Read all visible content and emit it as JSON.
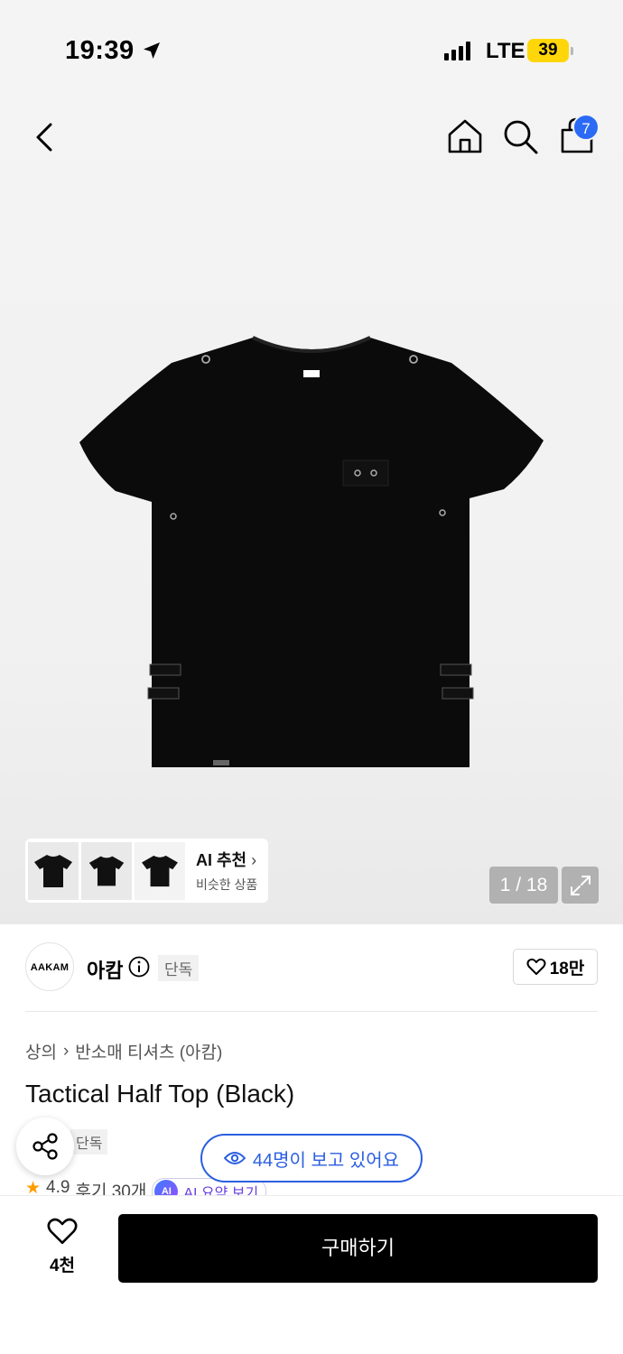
{
  "status_bar": {
    "time": "19:39",
    "network": "LTE",
    "battery": "39"
  },
  "nav": {
    "cart_count": "7",
    "icons": [
      "back-chevron-icon",
      "home-icon",
      "search-icon",
      "shopping-bag-icon"
    ]
  },
  "gallery": {
    "ai_title": "AI 추천",
    "ai_subtitle": "비슷한 상품",
    "page_counter": "1 / 18",
    "thumbnail_count": 3
  },
  "brand": {
    "logo_text": "AAKAM",
    "name": "아캄",
    "exclusive_label": "단독",
    "likes": "18만"
  },
  "product": {
    "breadcrumb": [
      "상의",
      "반소매 티셔츠 (아캄)"
    ],
    "title": "Tactical Half Top (Black)",
    "tag": "단독",
    "viewers": "44명이 보고 있어요",
    "rating": "4.9",
    "reviews": "후기 30개",
    "ai_summary": "AI 요약 보기"
  },
  "bottom": {
    "wish_count": "4천",
    "buy_label": "구매하기"
  },
  "colors": {
    "accent_blue": "#2b5fe0",
    "badge_blue": "#2b6af4",
    "battery": "#ffd60a",
    "star": "#ff9c00"
  }
}
